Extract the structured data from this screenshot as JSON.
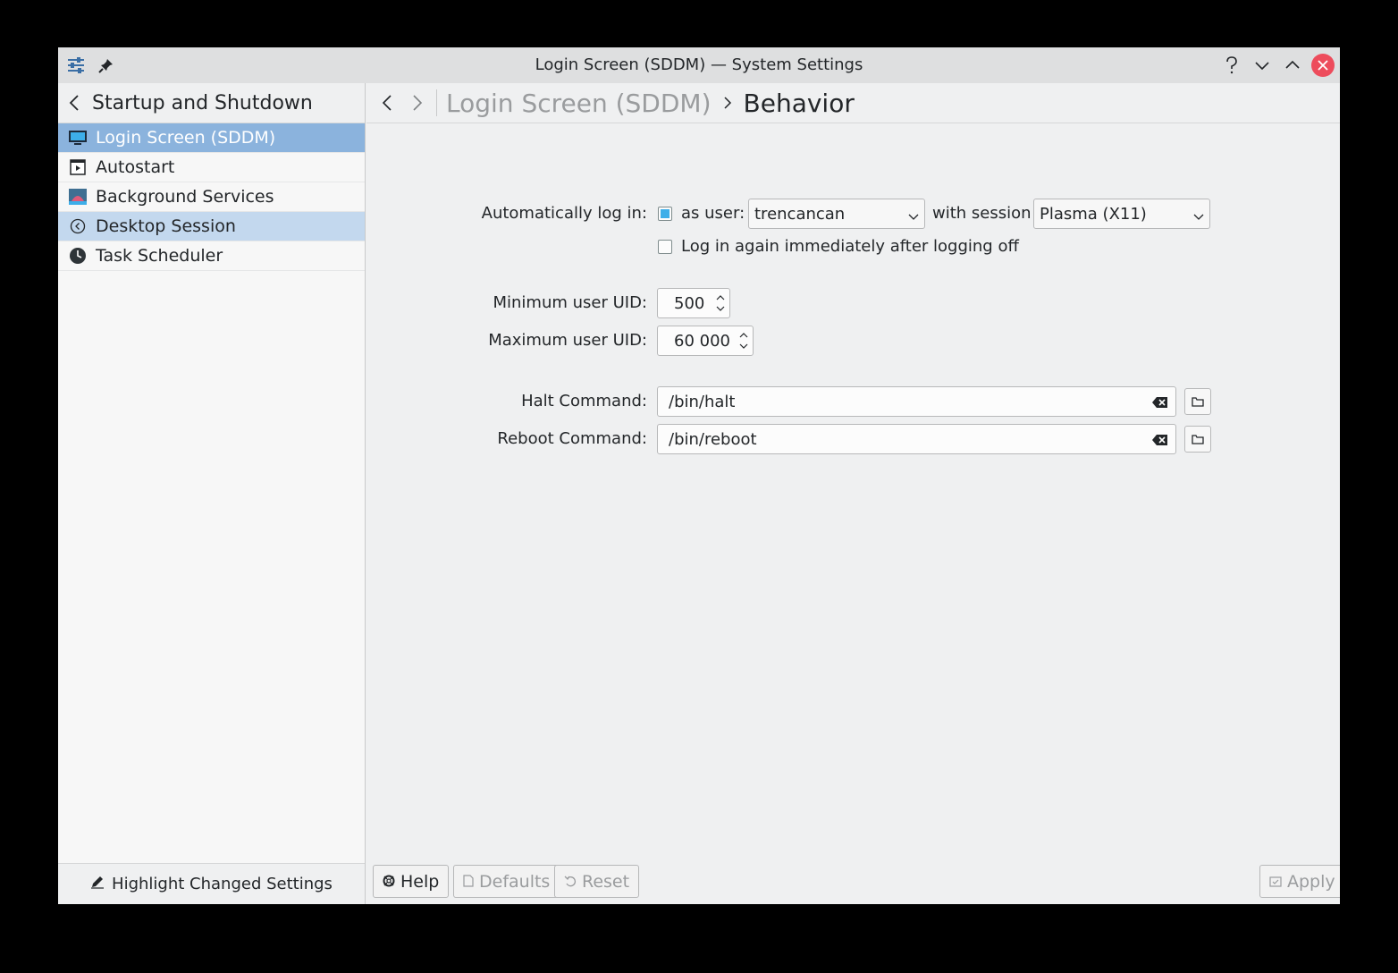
{
  "window": {
    "title": "Login Screen (SDDM) — System Settings"
  },
  "sidebar": {
    "header": "Startup and Shutdown",
    "items": [
      {
        "label": "Login Screen (SDDM)",
        "icon": "monitor-icon",
        "state": "selected"
      },
      {
        "label": "Autostart",
        "icon": "autostart-icon",
        "state": "normal"
      },
      {
        "label": "Background Services",
        "icon": "services-icon",
        "state": "normal"
      },
      {
        "label": "Desktop Session",
        "icon": "session-icon",
        "state": "hover"
      },
      {
        "label": "Task Scheduler",
        "icon": "clock-icon",
        "state": "normal"
      }
    ],
    "footer_label": "Highlight Changed Settings"
  },
  "breadcrumb": {
    "parent": "Login Screen (SDDM)",
    "current": "Behavior"
  },
  "form": {
    "autologin_label": "Automatically log in:",
    "autologin_checked": true,
    "as_user_label": "as user:",
    "user_value": "trencancan",
    "with_session_label": "with session",
    "session_value": "Plasma (X11)",
    "relogin_label": "Log in again immediately after logging off",
    "relogin_checked": false,
    "min_uid_label": "Minimum user UID:",
    "min_uid_value": "500",
    "max_uid_label": "Maximum user UID:",
    "max_uid_value": "60 000",
    "halt_label": "Halt Command:",
    "halt_value": "/bin/halt",
    "reboot_label": "Reboot Command:",
    "reboot_value": "/bin/reboot"
  },
  "footer": {
    "help_label": "Help",
    "defaults_label": "Defaults",
    "reset_label": "Reset",
    "apply_label": "Apply"
  },
  "colors": {
    "selection": "#8bb3dd",
    "hover": "#c3d8ee",
    "accent": "#3daee9",
    "close": "#ed4c5c"
  }
}
